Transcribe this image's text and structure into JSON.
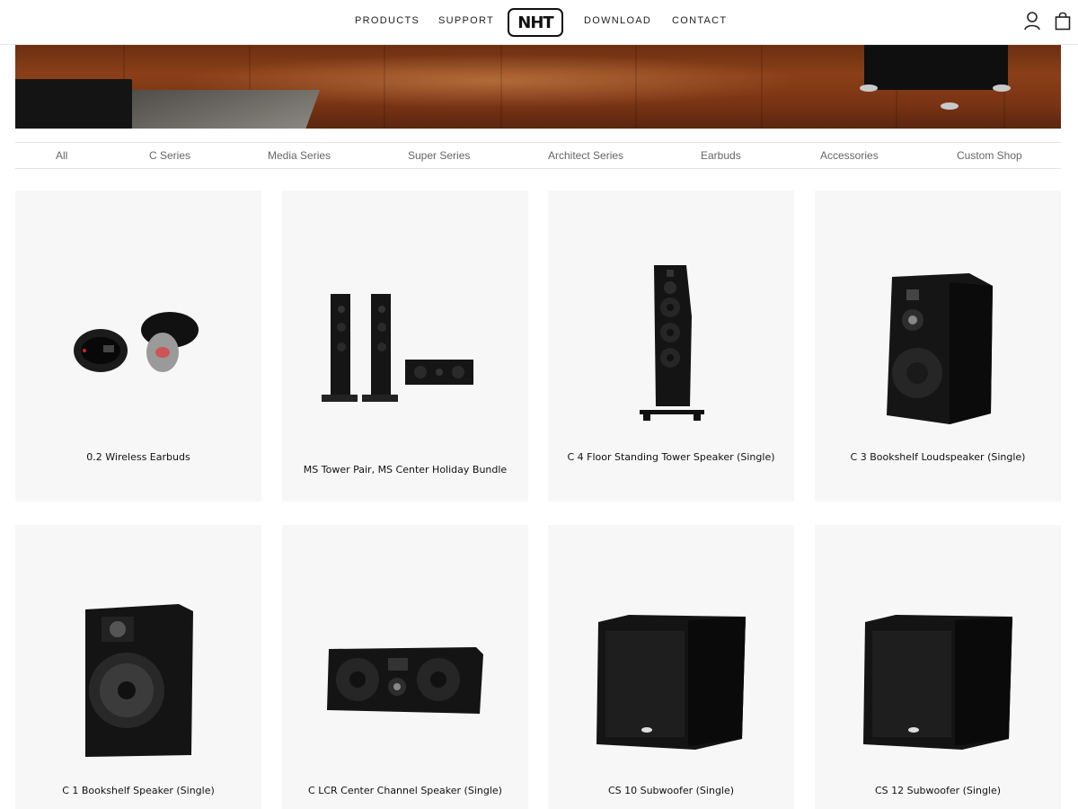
{
  "header": {
    "nav_left": [
      "PRODUCTS",
      "SUPPORT"
    ],
    "logo_text": "NHT",
    "nav_right": [
      "DOWNLOAD",
      "CONTACT"
    ],
    "icons": [
      "account-icon",
      "cart-icon"
    ]
  },
  "filters": [
    "All",
    "C Series",
    "Media Series",
    "Super Series",
    "Architect Series",
    "Earbuds",
    "Accessories",
    "Custom Shop"
  ],
  "products": [
    {
      "name": "0.2 Wireless Earbuds"
    },
    {
      "name": "MS Tower Pair, MS Center Holiday Bundle"
    },
    {
      "name": "C 4 Floor Standing Tower Speaker (Single)"
    },
    {
      "name": "C 3 Bookshelf Loudspeaker (Single)"
    },
    {
      "name": "C 1 Bookshelf Speaker (Single)"
    },
    {
      "name": "C LCR Center Channel Speaker (Single)"
    },
    {
      "name": "CS 10 Subwoofer (Single)"
    },
    {
      "name": "CS 12 Subwoofer (Single)"
    }
  ],
  "colors": {
    "card_bg": "#f7f7f7",
    "speaker_black": "#141414",
    "wood": "#7a3414"
  }
}
